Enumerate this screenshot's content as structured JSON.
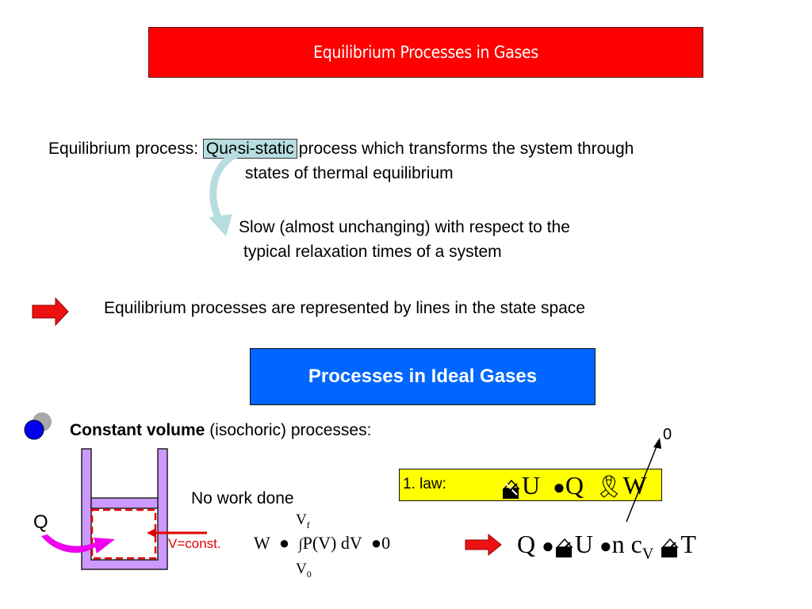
{
  "title": "Equilibrium Processes in Gases",
  "definition": {
    "label": "Equilibrium process:",
    "highlight": "Quasi-static",
    "rest_line1": "process which transforms the system through",
    "line2": "states of thermal equilibrium"
  },
  "explanation": {
    "line1": "Slow (almost unchanging) with respect to the",
    "line2": "typical relaxation times of a system"
  },
  "statement": "Equilibrium processes are represented by lines in the state space",
  "section_header": "Processes in Ideal Gases",
  "bullet": {
    "bold": "Constant volume",
    "rest": " (isochoric) processes:"
  },
  "diagram": {
    "heat_label": "Q",
    "volume_label": "V=const.",
    "no_work_label": "No work done"
  },
  "work_equation": {
    "lhs": "W",
    "upper_limit": "V",
    "upper_sub": "f",
    "lower_limit": "V",
    "lower_sub": "0",
    "integrand": "P(V) dV",
    "result": "0"
  },
  "first_law": {
    "label": "1. law:",
    "terms": [
      "U",
      "Q",
      "W"
    ],
    "annotation": "0"
  },
  "result_equation": {
    "q": "Q",
    "u": "U",
    "n": "n c",
    "sub": "V",
    "t": "T"
  },
  "colors": {
    "title_bg": "#ff0000",
    "section_bg": "#0066ff",
    "law_bg": "#ffff00",
    "highlight_bg": "#b7dde0",
    "container": "#cc99ff",
    "heat_arrow": "#ee00ee",
    "volume_red": "#e00000"
  }
}
